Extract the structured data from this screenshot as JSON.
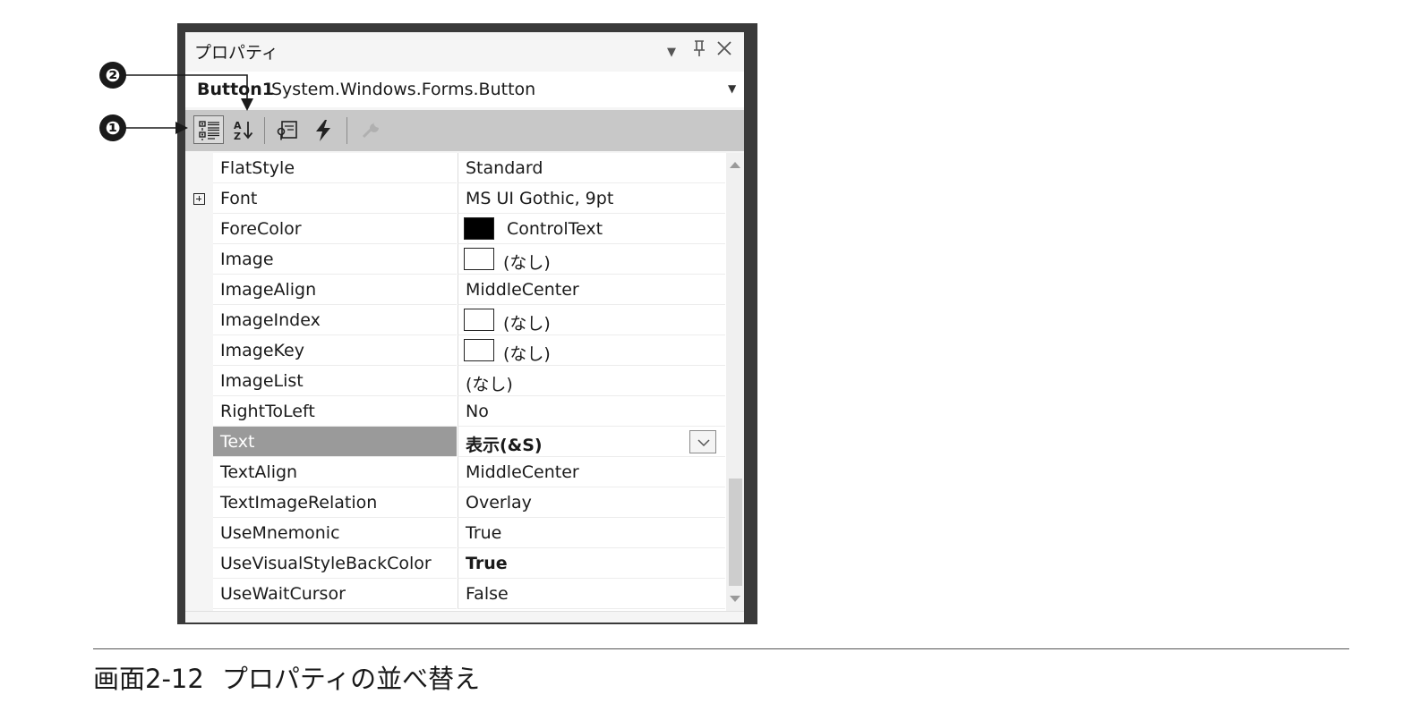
{
  "window": {
    "title": "プロパティ",
    "icons": [
      "dropdown-arrow-icon",
      "pin-icon",
      "close-icon"
    ]
  },
  "object_selector": {
    "name": "Button1",
    "type": "System.Windows.Forms.Button"
  },
  "toolbar": {
    "buttons": [
      "categorized-icon",
      "alphabetical-icon",
      "properties-icon",
      "events-icon",
      "property-pages-icon"
    ],
    "active": "categorized"
  },
  "properties": [
    {
      "name": "FlatStyle",
      "value": "Standard"
    },
    {
      "name": "Font",
      "value": "MS UI Gothic, 9pt",
      "expandable": true
    },
    {
      "name": "ForeColor",
      "value": "ControlText",
      "swatch": "#000000"
    },
    {
      "name": "Image",
      "value": "(なし)",
      "swatch": "#ffffff"
    },
    {
      "name": "ImageAlign",
      "value": "MiddleCenter"
    },
    {
      "name": "ImageIndex",
      "value": "(なし)",
      "swatch": "#ffffff"
    },
    {
      "name": "ImageKey",
      "value": "(なし)",
      "swatch": "#ffffff"
    },
    {
      "name": "ImageList",
      "value": "(なし)"
    },
    {
      "name": "RightToLeft",
      "value": "No"
    },
    {
      "name": "Text",
      "value": "表示(&S)",
      "selected": true
    },
    {
      "name": "TextAlign",
      "value": "MiddleCenter"
    },
    {
      "name": "TextImageRelation",
      "value": "Overlay"
    },
    {
      "name": "UseMnemonic",
      "value": "True"
    },
    {
      "name": "UseVisualStyleBackColor",
      "value": "True"
    },
    {
      "name": "UseWaitCursor",
      "value": "False"
    }
  ],
  "callouts": {
    "one": "❶",
    "two": "❷"
  },
  "caption": {
    "number": "画面2-12",
    "text": "プロパティの並べ替え"
  },
  "colors": {
    "selected_row": "#9a9a9a",
    "toolbar": "#c8c8c8",
    "frame": "#3a3a3a"
  }
}
